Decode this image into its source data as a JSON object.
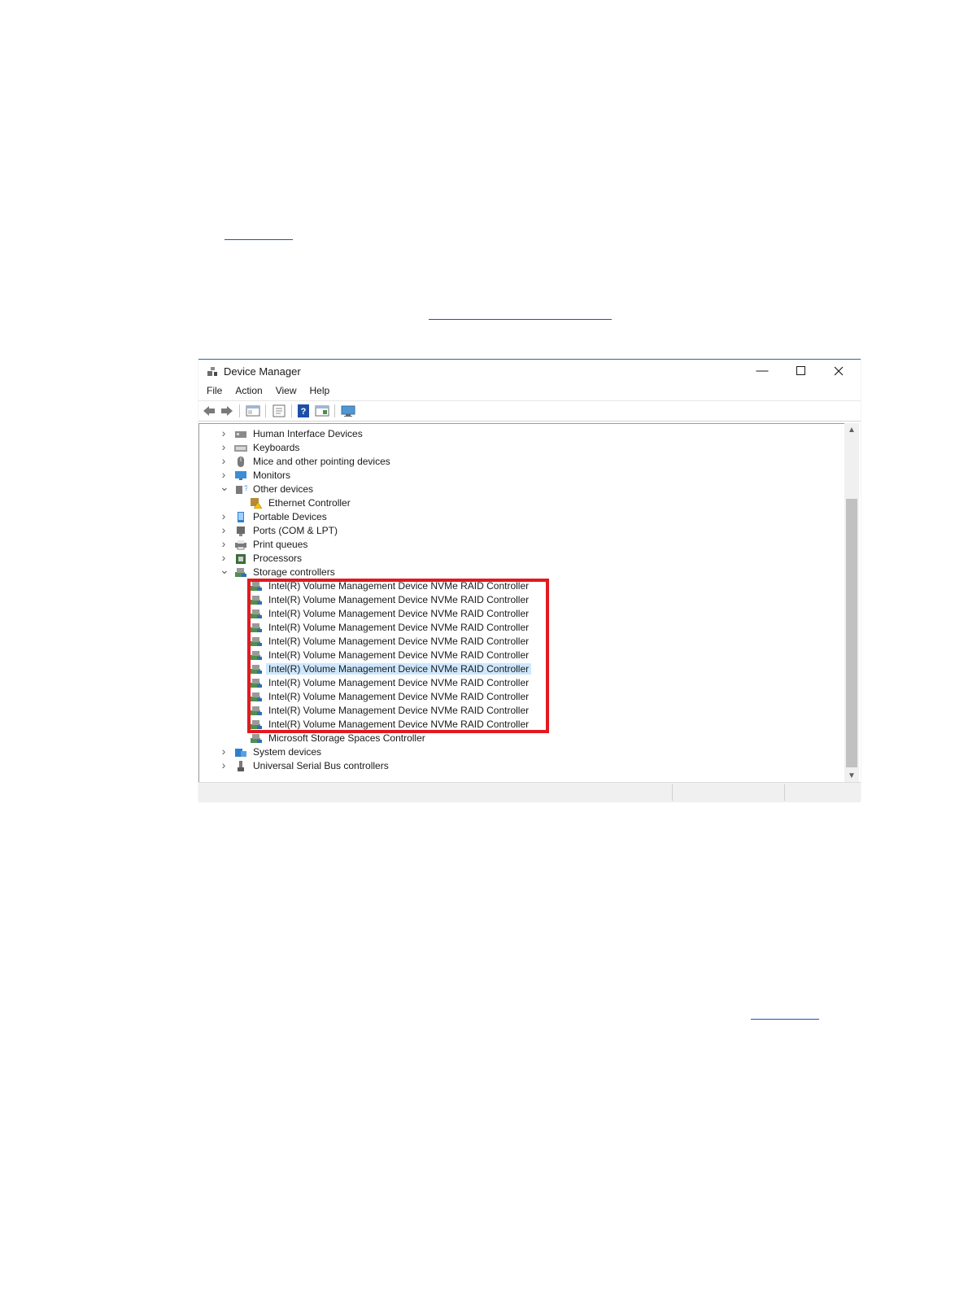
{
  "window": {
    "title": "Device Manager",
    "menu": [
      "File",
      "Action",
      "View",
      "Help"
    ]
  },
  "tree": {
    "items": [
      {
        "label": "Human Interface Devices",
        "level": 0,
        "expanded": false,
        "icon": "hid-icon"
      },
      {
        "label": "Keyboards",
        "level": 0,
        "expanded": false,
        "icon": "keyboard-icon"
      },
      {
        "label": "Mice and other pointing devices",
        "level": 0,
        "expanded": false,
        "icon": "mouse-icon"
      },
      {
        "label": "Monitors",
        "level": 0,
        "expanded": false,
        "icon": "monitor-icon"
      },
      {
        "label": "Other devices",
        "level": 0,
        "expanded": true,
        "icon": "unknown-device-icon"
      },
      {
        "label": "Ethernet Controller",
        "level": 1,
        "icon": "warning-device-icon"
      },
      {
        "label": "Portable Devices",
        "level": 0,
        "expanded": false,
        "icon": "portable-device-icon"
      },
      {
        "label": "Ports (COM & LPT)",
        "level": 0,
        "expanded": false,
        "icon": "port-icon"
      },
      {
        "label": "Print queues",
        "level": 0,
        "expanded": false,
        "icon": "printer-icon"
      },
      {
        "label": "Processors",
        "level": 0,
        "expanded": false,
        "icon": "processor-icon"
      },
      {
        "label": "Storage controllers",
        "level": 0,
        "expanded": true,
        "icon": "storage-controller-icon"
      },
      {
        "label": "Intel(R) Volume Management Device NVMe RAID Controller",
        "level": 1,
        "icon": "storage-controller-icon"
      },
      {
        "label": "Intel(R) Volume Management Device NVMe RAID Controller",
        "level": 1,
        "icon": "storage-controller-icon"
      },
      {
        "label": "Intel(R) Volume Management Device NVMe RAID Controller",
        "level": 1,
        "icon": "storage-controller-icon"
      },
      {
        "label": "Intel(R) Volume Management Device NVMe RAID Controller",
        "level": 1,
        "icon": "storage-controller-icon"
      },
      {
        "label": "Intel(R) Volume Management Device NVMe RAID Controller",
        "level": 1,
        "icon": "storage-controller-icon"
      },
      {
        "label": "Intel(R) Volume Management Device NVMe RAID Controller",
        "level": 1,
        "icon": "storage-controller-icon"
      },
      {
        "label": "Intel(R) Volume Management Device NVMe RAID Controller",
        "level": 1,
        "icon": "storage-controller-icon",
        "selected": true
      },
      {
        "label": "Intel(R) Volume Management Device NVMe RAID Controller",
        "level": 1,
        "icon": "storage-controller-icon"
      },
      {
        "label": "Intel(R) Volume Management Device NVMe RAID Controller",
        "level": 1,
        "icon": "storage-controller-icon"
      },
      {
        "label": "Intel(R) Volume Management Device NVMe RAID Controller",
        "level": 1,
        "icon": "storage-controller-icon"
      },
      {
        "label": "Intel(R) Volume Management Device NVMe RAID Controller",
        "level": 1,
        "icon": "storage-controller-icon"
      },
      {
        "label": "Microsoft Storage Spaces Controller",
        "level": 1,
        "icon": "storage-controller-icon"
      },
      {
        "label": "System devices",
        "level": 0,
        "expanded": false,
        "icon": "system-devices-icon"
      },
      {
        "label": "Universal Serial Bus controllers",
        "level": 0,
        "expanded": false,
        "icon": "usb-icon"
      }
    ]
  },
  "colors": {
    "highlight_box": "#e3191f",
    "selection": "#cde8ff",
    "title_accent": "#2b6fb8"
  }
}
